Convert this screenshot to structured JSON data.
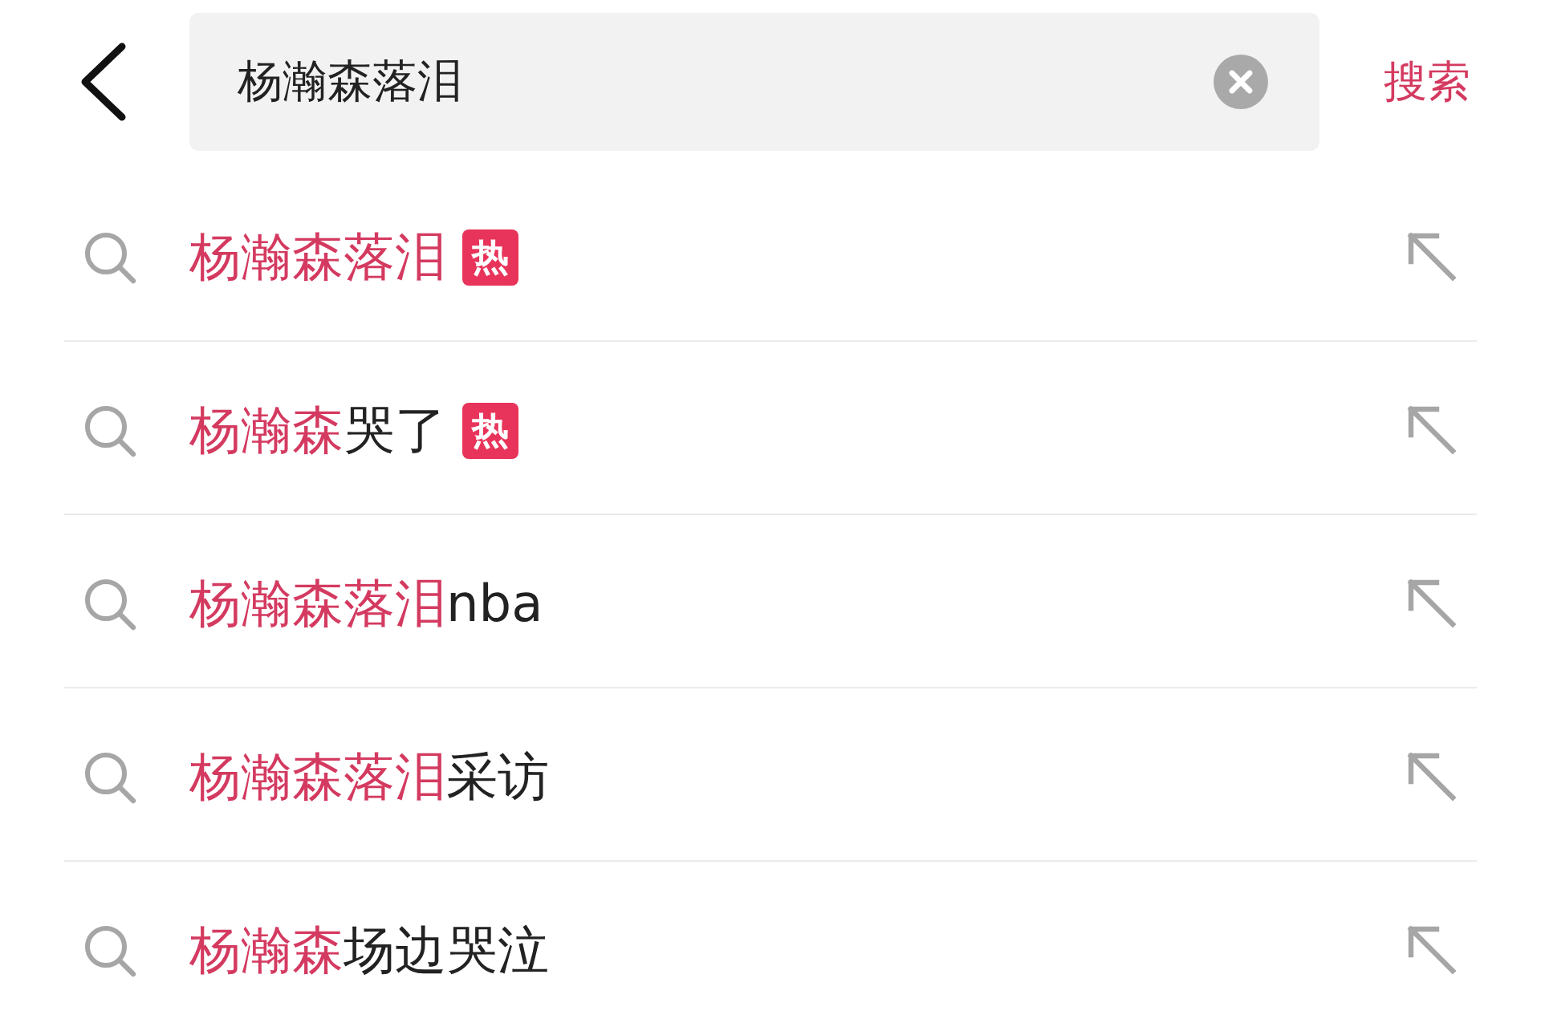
{
  "header": {
    "query": "杨瀚森落泪",
    "search_button": "搜索"
  },
  "suggestions": [
    {
      "parts": [
        {
          "text": "杨瀚森落泪",
          "highlight": true
        }
      ],
      "badge": "热"
    },
    {
      "parts": [
        {
          "text": "杨瀚森",
          "highlight": true
        },
        {
          "text": "哭了",
          "highlight": false
        }
      ],
      "badge": "热"
    },
    {
      "parts": [
        {
          "text": "杨瀚森落泪",
          "highlight": true
        },
        {
          "text": "nba",
          "highlight": false
        }
      ]
    },
    {
      "parts": [
        {
          "text": "杨瀚森落泪",
          "highlight": true
        },
        {
          "text": "采访",
          "highlight": false
        }
      ]
    },
    {
      "parts": [
        {
          "text": "杨瀚森",
          "highlight": true
        },
        {
          "text": "场边哭泣",
          "highlight": false
        }
      ]
    }
  ]
}
